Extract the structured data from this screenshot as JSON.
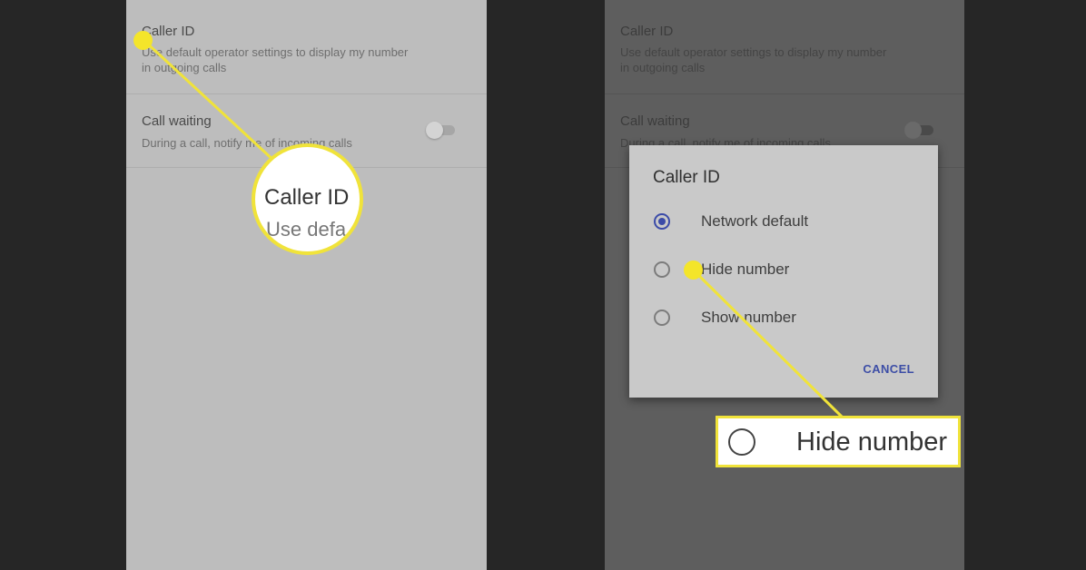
{
  "settings": {
    "caller_id": {
      "title": "Caller ID",
      "subtitle_line1": "Use default operator settings to display my number",
      "subtitle_line2": "in outgoing calls"
    },
    "call_waiting": {
      "title": "Call waiting",
      "subtitle": "During a call, notify me of incoming calls",
      "enabled": false
    }
  },
  "dialog": {
    "title": "Caller ID",
    "options": [
      {
        "label": "Network default",
        "selected": true
      },
      {
        "label": "Hide number",
        "selected": false
      },
      {
        "label": "Show number",
        "selected": false
      }
    ],
    "cancel_label": "CANCEL"
  },
  "callouts": {
    "left_zoom_title": "Caller ID",
    "left_zoom_sub": "Use defa",
    "right_zoom_label": "Hide number"
  },
  "colors": {
    "highlight": "#f0e33a",
    "accent": "#3b4ba8"
  }
}
